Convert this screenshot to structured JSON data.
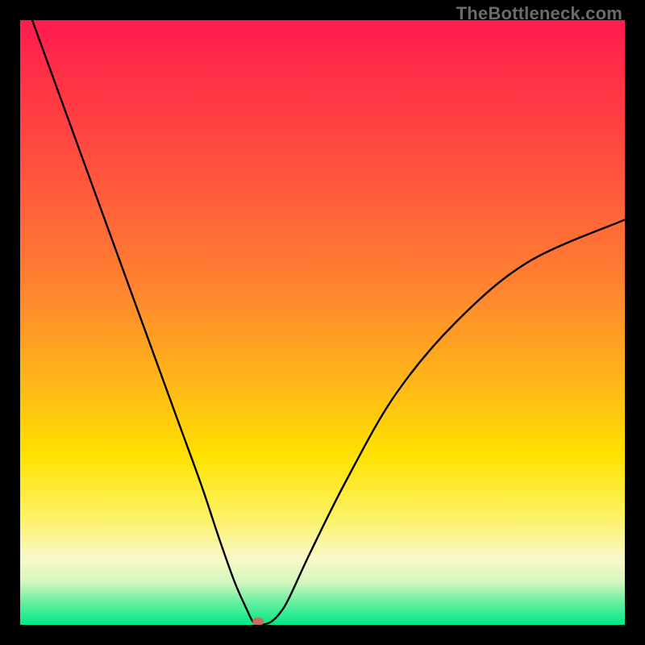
{
  "watermark": "TheBottleneck.com",
  "chart_data": {
    "type": "line",
    "title": "",
    "xlabel": "",
    "ylabel": "",
    "x_range": [
      0,
      100
    ],
    "y_range": [
      0,
      100
    ],
    "series": [
      {
        "name": "bottleneck-curve",
        "x": [
          2,
          6,
          10,
          14,
          18,
          22,
          26,
          30,
          33,
          35.5,
          37.5,
          38.5,
          39.5,
          40,
          41.5,
          43,
          44.5,
          48,
          54,
          62,
          72,
          84,
          100
        ],
        "y": [
          100,
          89,
          78,
          67,
          56,
          45,
          34,
          23,
          14,
          7,
          2.5,
          0.5,
          0,
          0,
          0.5,
          2,
          4.5,
          12,
          24,
          38,
          50,
          60,
          67
        ]
      }
    ],
    "optimum_marker": {
      "x": 39.3,
      "y": 0.5
    },
    "background_gradient": {
      "stops": [
        {
          "pct": 0,
          "color": "#ff1a4f"
        },
        {
          "pct": 18,
          "color": "#ff4340"
        },
        {
          "pct": 44,
          "color": "#ff8330"
        },
        {
          "pct": 72,
          "color": "#ffe100"
        },
        {
          "pct": 89,
          "color": "#faf8c8"
        },
        {
          "pct": 100,
          "color": "#00e989"
        }
      ]
    }
  }
}
